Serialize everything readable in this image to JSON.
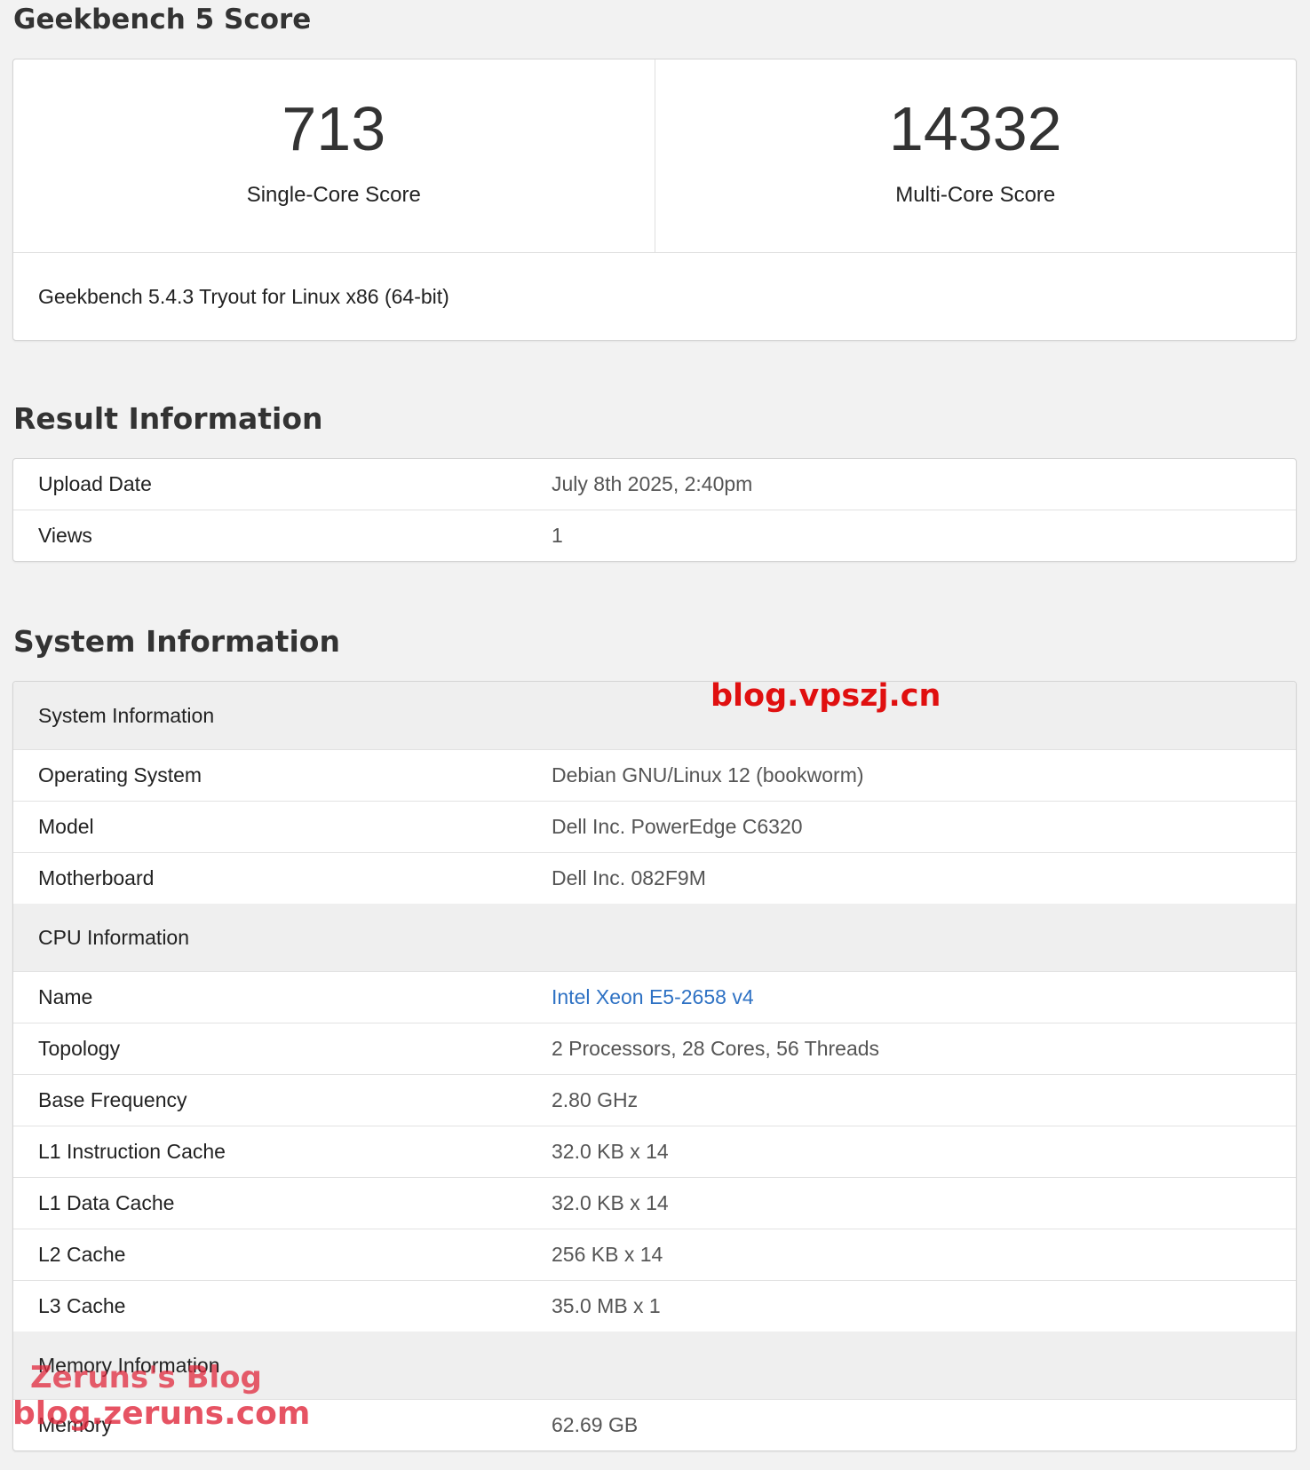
{
  "score_section": {
    "title": "Geekbench 5 Score",
    "single_core": {
      "value": "713",
      "label": "Single-Core Score"
    },
    "multi_core": {
      "value": "14332",
      "label": "Multi-Core Score"
    },
    "version": "Geekbench 5.4.3 Tryout for Linux x86 (64-bit)"
  },
  "result_info": {
    "title": "Result Information",
    "rows": [
      {
        "key": "Upload Date",
        "value": "July 8th 2025, 2:40pm"
      },
      {
        "key": "Views",
        "value": "1"
      }
    ]
  },
  "system_info": {
    "title": "System Information",
    "system": {
      "header": "System Information",
      "rows": [
        {
          "key": "Operating System",
          "value": "Debian GNU/Linux 12 (bookworm)"
        },
        {
          "key": "Model",
          "value": "Dell Inc. PowerEdge C6320"
        },
        {
          "key": "Motherboard",
          "value": "Dell Inc. 082F9M"
        }
      ]
    },
    "cpu": {
      "header": "CPU Information",
      "rows": [
        {
          "key": "Name",
          "value": "Intel Xeon E5-2658 v4"
        },
        {
          "key": "Topology",
          "value": "2 Processors, 28 Cores, 56 Threads"
        },
        {
          "key": "Base Frequency",
          "value": "2.80 GHz"
        },
        {
          "key": "L1 Instruction Cache",
          "value": "32.0 KB x 14"
        },
        {
          "key": "L1 Data Cache",
          "value": "32.0 KB x 14"
        },
        {
          "key": "L2 Cache",
          "value": "256 KB x 14"
        },
        {
          "key": "L3 Cache",
          "value": "35.0 MB x 1"
        }
      ]
    },
    "memory": {
      "header": "Memory Information",
      "rows": [
        {
          "key": "Memory",
          "value": "62.69 GB"
        }
      ]
    }
  },
  "watermarks": {
    "top": "blog.vpszj.cn",
    "bottom_line1": "Zeruns's Blog",
    "bottom_line2": "blog.zeruns.com"
  },
  "colors": {
    "link": "#2f72c4",
    "watermark": "#e01010"
  }
}
